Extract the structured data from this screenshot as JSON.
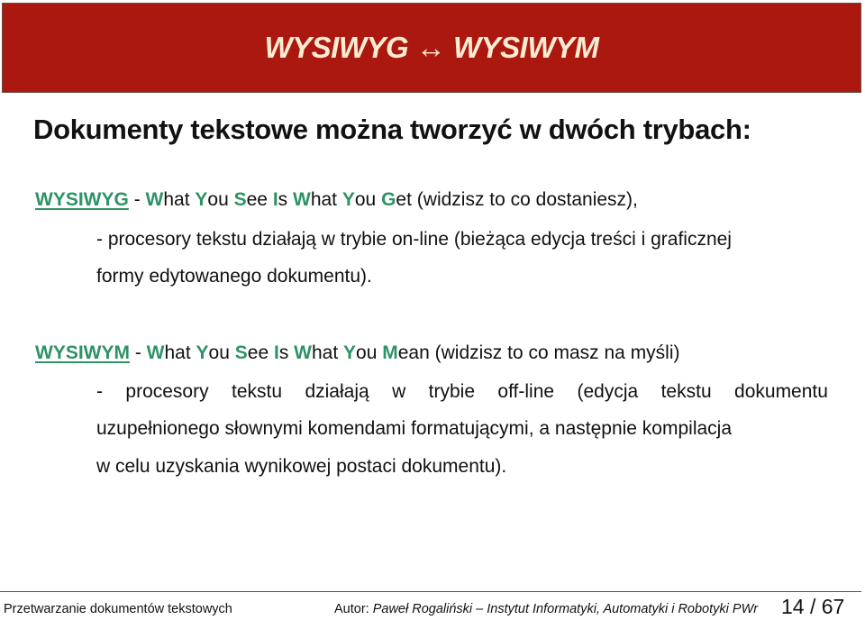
{
  "header": {
    "title": "WYSIWYG ↔ WYSIWYM",
    "colors": {
      "background": "#ab1810",
      "text": "#fdecd2"
    }
  },
  "subtitle": "Dokumenty tekstowe można tworzyć w dwóch trybach:",
  "accent_color": "#2e9364",
  "sections": [
    {
      "term": "WYSIWYG",
      "expansion_parts": [
        {
          "hl": "W",
          "rest": "hat "
        },
        {
          "hl": "Y",
          "rest": "ou "
        },
        {
          "hl": "S",
          "rest": "ee "
        },
        {
          "hl": "I",
          "rest": "s "
        },
        {
          "hl": "W",
          "rest": "hat "
        },
        {
          "hl": "Y",
          "rest": "ou "
        },
        {
          "hl": "G",
          "rest": "et"
        }
      ],
      "gloss": "(widzisz to co dostaniesz),",
      "description_lines": [
        "- procesory tekstu działają w trybie on-line (bieżąca edycja treści i graficznej",
        "formy edytowanego dokumentu)."
      ]
    },
    {
      "term": "WYSIWYM",
      "expansion_parts": [
        {
          "hl": "W",
          "rest": "hat "
        },
        {
          "hl": "Y",
          "rest": "ou "
        },
        {
          "hl": "S",
          "rest": "ee "
        },
        {
          "hl": "I",
          "rest": "s "
        },
        {
          "hl": "W",
          "rest": "hat "
        },
        {
          "hl": "Y",
          "rest": "ou "
        },
        {
          "hl": "M",
          "rest": "ean"
        }
      ],
      "gloss": "(widzisz to co masz na myśli)",
      "description_lines": [
        "- procesory tekstu działają w trybie off-line (edycja tekstu dokumentu",
        "uzupełnionego słownymi komendami formatującymi, a następnie kompilacja",
        "w celu uzyskania wynikowej postaci dokumentu)."
      ]
    }
  ],
  "footer": {
    "course": "Przetwarzanie dokumentów tekstowych",
    "author_label": "Autor:",
    "author_name": "Paweł Rogaliński – Instytut Informatyki, Automatyki i Robotyki PWr",
    "page": "14 / 67"
  }
}
